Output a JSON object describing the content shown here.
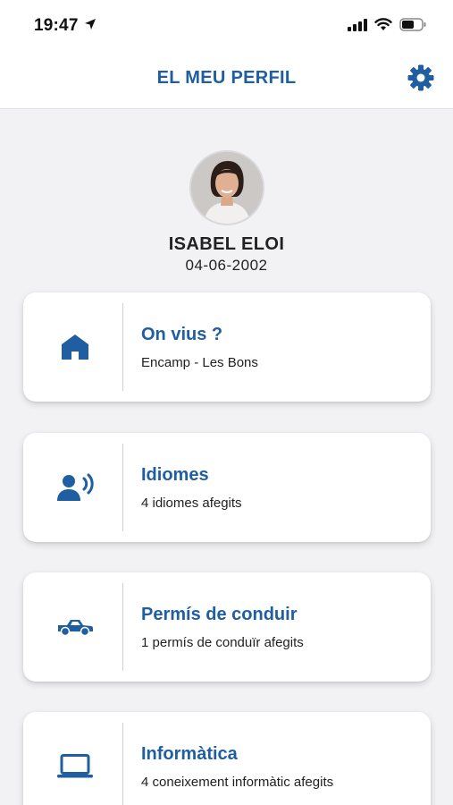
{
  "status_bar": {
    "time": "19:47",
    "icons": [
      "location-arrow-icon",
      "signal-icon",
      "wifi-icon",
      "battery-icon"
    ]
  },
  "header": {
    "title": "EL MEU PERFIL",
    "settings_icon": "gear-icon",
    "accent_color": "#1f5ea0"
  },
  "profile": {
    "name": "ISABEL ELOI",
    "birth_date": "04-06-2002"
  },
  "cards": [
    {
      "icon": "home-icon",
      "title": "On vius ?",
      "subtitle": "Encamp - Les Bons"
    },
    {
      "icon": "speaking-person-icon",
      "title": "Idiomes",
      "subtitle": "4 idiomes afegits"
    },
    {
      "icon": "car-icon",
      "title": "Permís de conduir",
      "subtitle": "1 permís de conduïr afegits"
    },
    {
      "icon": "laptop-icon",
      "title": "Informàtica",
      "subtitle": "4 coneixement informàtic afegits"
    }
  ]
}
